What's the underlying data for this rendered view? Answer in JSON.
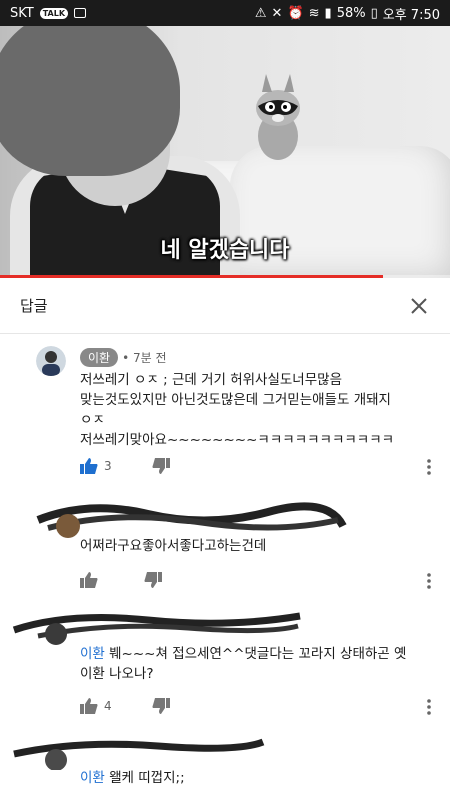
{
  "status_bar": {
    "carrier": "SKT",
    "battery": "58%",
    "time": "오후 7:50"
  },
  "video": {
    "caption": "네 알겠습니다",
    "progress": 0.85
  },
  "replies_panel": {
    "title": "답글"
  },
  "comments": [
    {
      "author": "이환",
      "time": "• 7분 전",
      "text": "저쓰레기 ㅇㅈ ; 근데 거기 허위사실도너무많음\n맞는것도있지만 아닌것도많은데 그거믿는애들도 개돼지\nㅇㅈ\n저쓰레기맞아요~~~~~~~~ㅋㅋㅋㅋㅋㅋㅋㅋㅋㅋㅋ",
      "likes": "3"
    },
    {
      "text": "어쩌라구요좋아서좋다고하는건데",
      "likes": ""
    },
    {
      "mention": "이환",
      "text": " 붸~~~쳐 접으세연^^댓글다는 꼬라지 상태하곤 옛\n이환 나오나?",
      "likes": "4"
    },
    {
      "mention": "이환",
      "text": " 왤케 띠껍지;;"
    }
  ],
  "colors": {
    "accent_link": "#1f6fd1",
    "like_active": "#1e6fcf",
    "progress": "#e52d27"
  }
}
